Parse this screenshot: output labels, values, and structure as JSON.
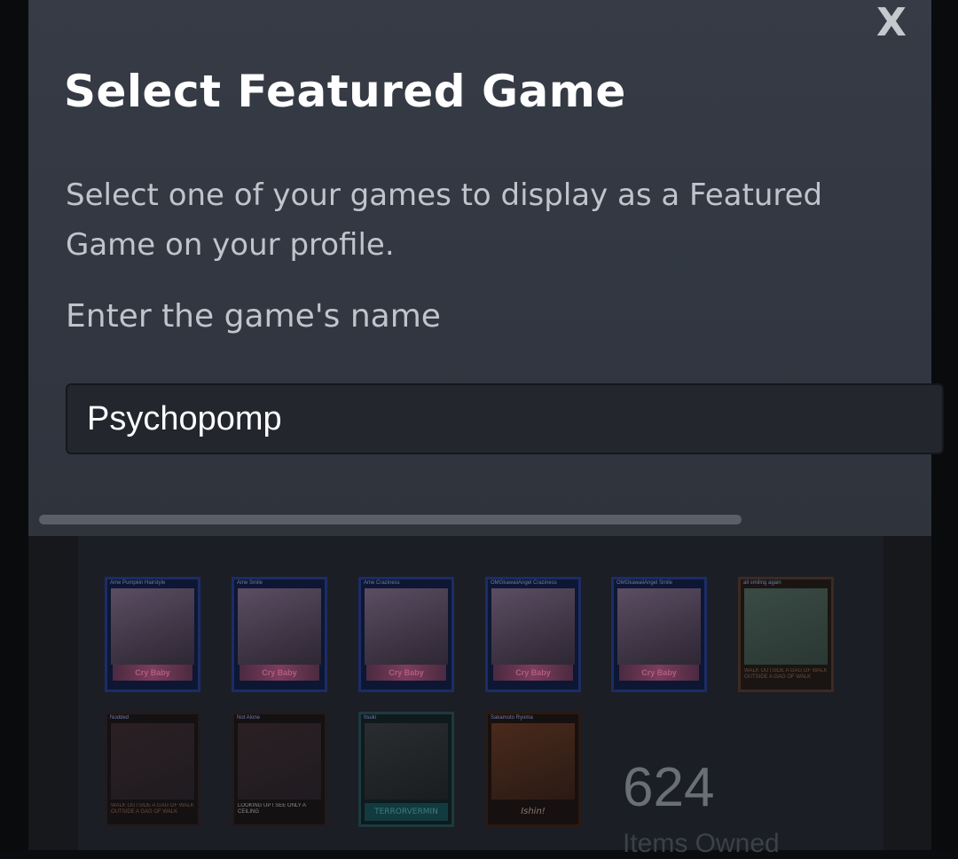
{
  "dialog": {
    "close_label": "X",
    "title": "Select Featured Game",
    "description": "Select one of your games to display as a Featured Game on your profile.",
    "field_label": "Enter the game's name",
    "search_value": "Psychopomp"
  },
  "background": {
    "cards_row1": [
      {
        "caption": "Ame Pumpkin Hairstyle",
        "banner": "Cry Baby"
      },
      {
        "caption": "Ame Smile",
        "banner": "Cry Baby"
      },
      {
        "caption": "Ame Craziness",
        "banner": "Cry Baby"
      },
      {
        "caption": "OMGkawaiiAngel Craziness",
        "banner": "Cry Baby"
      },
      {
        "caption": "OMGkawaiiAngel Smile",
        "banner": "Cry Baby"
      },
      {
        "caption": "all smiling again",
        "footer": "WALK OUTSIDE A GAG OF WALK OUTSIDE A GAG OF WALK"
      }
    ],
    "cards_row2": [
      {
        "caption": "Nodded",
        "footer": "WALK OUTSIDE A GAG OF WALK OUTSIDE A GAG OF WALK"
      },
      {
        "caption": "Not Alone",
        "footer": "LOOKING UP I SEE ONLY A CEILING"
      },
      {
        "caption": "Itsuki",
        "footer": "TERRORVERMIN"
      },
      {
        "caption": "Sakamoto Ryoma",
        "footer": "Ishin!"
      }
    ],
    "items_owned_count": "624",
    "items_owned_label": "Items Owned"
  }
}
